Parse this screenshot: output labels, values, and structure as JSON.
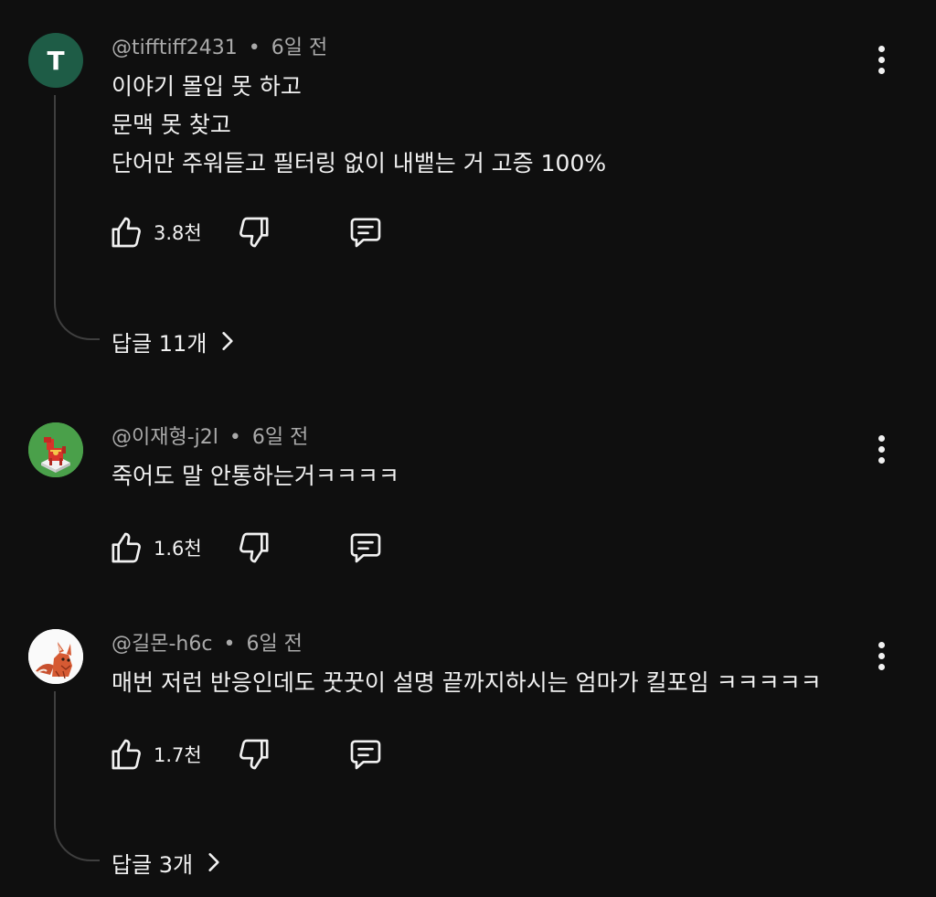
{
  "comments": [
    {
      "author": "@tifftiff2431",
      "time": "6일 전",
      "avatar_letter": "T",
      "lines": [
        "이야기 몰입 못 하고",
        "문맥 못 찾고",
        "단어만 주워듣고 필터링 없이 내뱉는 거 고증 100%"
      ],
      "likes": "3.8천",
      "replies": "답글 11개"
    },
    {
      "author": "@이재형-j2l",
      "time": "6일 전",
      "avatar_icon": "dala-horse-avatar",
      "lines": [
        "죽어도 말 안통하는거ㅋㅋㅋㅋ"
      ],
      "likes": "1.6천"
    },
    {
      "author": "@길몬-h6c",
      "time": "6일 전",
      "avatar_icon": "fox-avatar",
      "lines": [
        "매번 저런 반응인데도 꿋꿋이 설명 끝까지하시는 엄마가 킬포임 ㅋㅋㅋㅋㅋ"
      ],
      "likes": "1.7천",
      "replies": "답글 3개"
    }
  ],
  "icons": {
    "like": "thumbs-up-icon",
    "dislike": "thumbs-down-icon",
    "reply": "comment-icon",
    "more": "more-vert-icon",
    "chevron": "chevron-right-icon"
  },
  "colors": {
    "background": "#0f0f0f",
    "text": "#f1f1f1",
    "meta": "#aaaaaa",
    "avatar_t": "#1e5c46"
  }
}
